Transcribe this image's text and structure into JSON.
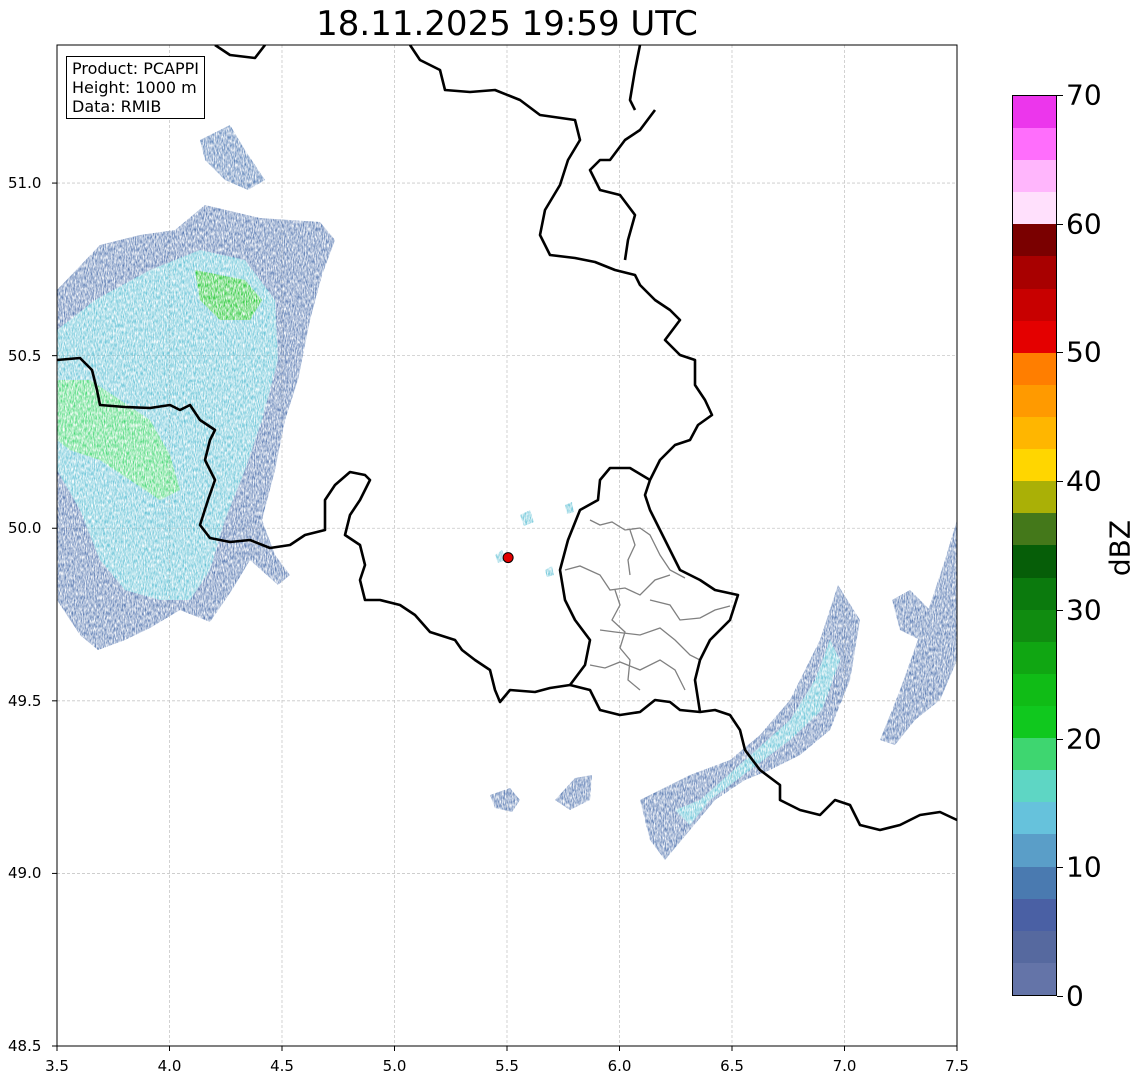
{
  "title": "18.11.2025 19:59 UTC",
  "info": {
    "product": "Product: PCAPPI",
    "height": "Height: 1000 m",
    "data": "Data: RMIB"
  },
  "map": {
    "lon_range": [
      3.5,
      7.5
    ],
    "lat_range": [
      48.5,
      51.4
    ],
    "x_ticks": [
      "3.5",
      "4.0",
      "4.5",
      "5.0",
      "5.5",
      "6.0",
      "6.5",
      "7.0",
      "7.5"
    ],
    "y_ticks": [
      "48.5",
      "49.0",
      "49.5",
      "50.0",
      "50.5",
      "51.0"
    ],
    "grid": "dashed",
    "radar_site": {
      "lon": 5.505,
      "lat": 49.915,
      "color": "#e00000"
    }
  },
  "colorbar": {
    "label": "dBZ",
    "ticks": [
      "0",
      "10",
      "20",
      "30",
      "40",
      "50",
      "60",
      "70"
    ],
    "colors": [
      "#6474a8",
      "#56699f",
      "#4a60a4",
      "#4a7ab0",
      "#5a9ec8",
      "#66c2dc",
      "#5ed6c4",
      "#3ed670",
      "#10c81e",
      "#10bc16",
      "#10a612",
      "#108c10",
      "#0b7a0d",
      "#065e08",
      "#44781a",
      "#aab006",
      "#ffd600",
      "#ffb600",
      "#ff9a00",
      "#ff7e00",
      "#e40000",
      "#c80000",
      "#a80000",
      "#7a0000",
      "#ffe0fc",
      "#ffb6fc",
      "#ff6efc",
      "#ec36ec"
    ]
  }
}
